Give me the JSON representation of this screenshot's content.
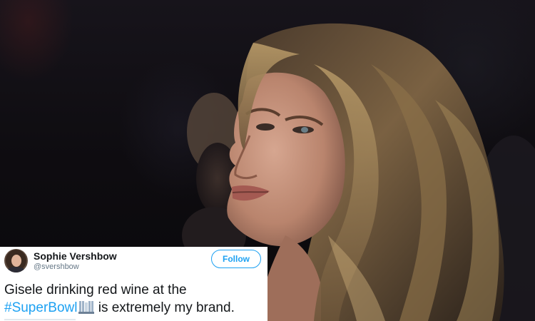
{
  "photo": {
    "subject": "woman-with-long-wavy-hair",
    "palette": {
      "background": "#0d0b0e",
      "hair_dark": "#3b2e24",
      "hair_light": "#a88a5c",
      "skin": "#c99883"
    }
  },
  "tweet": {
    "author_name": "Sophie Vershbow",
    "author_handle": "@svershbow",
    "follow_label": "Follow",
    "text_before": "Gisele drinking red wine at the",
    "hashtag": "#SuperBowl",
    "text_after": " is extremely my brand.",
    "emoji": "super-bowl-trophy-emoji",
    "accent": "#1da1f2"
  }
}
